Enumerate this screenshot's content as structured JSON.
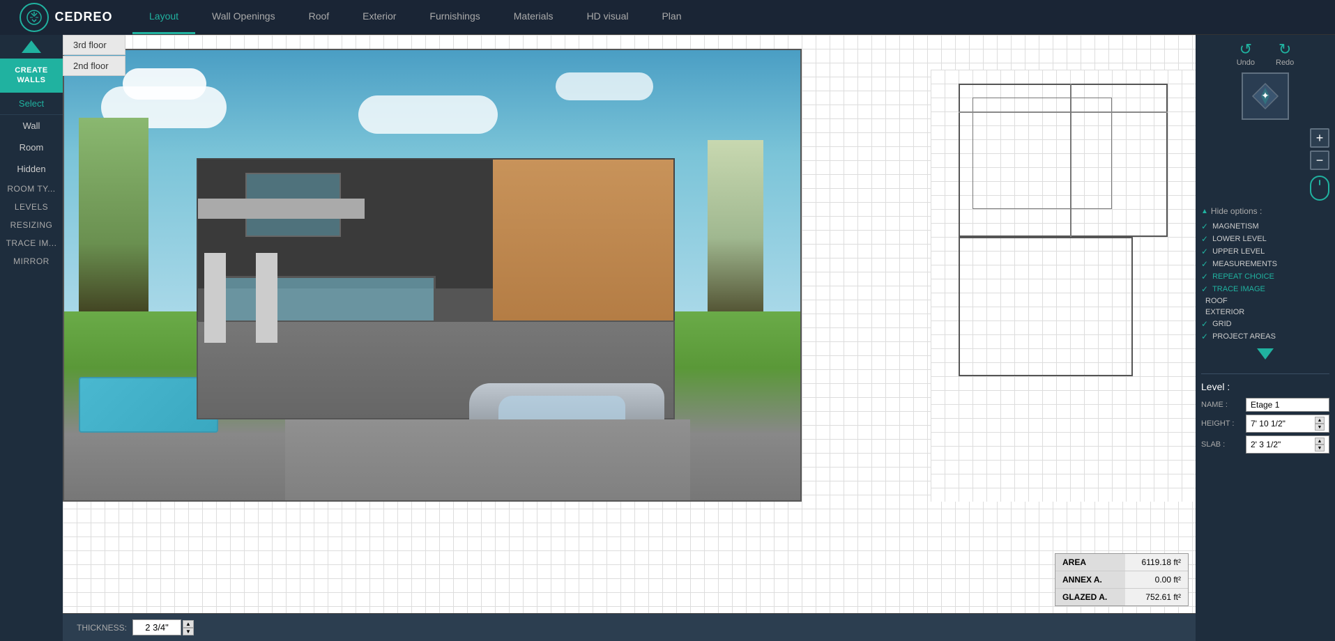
{
  "app": {
    "logo_text": "CEDREO"
  },
  "nav": {
    "tabs": [
      {
        "id": "layout",
        "label": "Layout",
        "active": true
      },
      {
        "id": "wall-openings",
        "label": "Wall Openings",
        "active": false
      },
      {
        "id": "roof",
        "label": "Roof",
        "active": false
      },
      {
        "id": "exterior",
        "label": "Exterior",
        "active": false
      },
      {
        "id": "furnishings",
        "label": "Furnishings",
        "active": false
      },
      {
        "id": "materials",
        "label": "Materials",
        "active": false
      },
      {
        "id": "hd-visual",
        "label": "HD visual",
        "active": false
      },
      {
        "id": "plan",
        "label": "Plan",
        "active": false
      }
    ]
  },
  "sidebar": {
    "create_walls_label": "CREATE WALLS",
    "select_label": "Select",
    "items": [
      {
        "id": "wall",
        "label": "Wall"
      },
      {
        "id": "room",
        "label": "Room"
      },
      {
        "id": "hidden",
        "label": "Hidden"
      }
    ],
    "sections": [
      {
        "id": "room-type",
        "label": "ROOM TY..."
      },
      {
        "id": "levels",
        "label": "LEVELS"
      },
      {
        "id": "resizing",
        "label": "RESIZING"
      },
      {
        "id": "trace-im",
        "label": "TRACE IM..."
      },
      {
        "id": "mirror",
        "label": "MIRROR"
      }
    ]
  },
  "floors": [
    {
      "id": "3rd-floor",
      "label": "3rd floor"
    },
    {
      "id": "2nd-floor",
      "label": "2nd floor"
    }
  ],
  "toolbar": {
    "undo_label": "Undo",
    "redo_label": "Redo"
  },
  "hide_options": {
    "header": "Hide options :",
    "options": [
      {
        "id": "magnetism",
        "label": "MAGNETISM",
        "checked": true
      },
      {
        "id": "lower-level",
        "label": "LOWER LEVEL",
        "checked": true
      },
      {
        "id": "upper-level",
        "label": "UPPER LEVEL",
        "checked": true
      },
      {
        "id": "measurements",
        "label": "MEASUREMENTS",
        "checked": true
      },
      {
        "id": "repeat-choice",
        "label": "REPEAT CHOICE",
        "checked": true,
        "highlighted": true
      },
      {
        "id": "trace-image",
        "label": "TRACE IMAGE",
        "checked": true,
        "highlighted": true
      },
      {
        "id": "roof",
        "label": "ROOF",
        "checked": false
      },
      {
        "id": "exterior",
        "label": "EXTERIOR",
        "checked": false
      },
      {
        "id": "grid",
        "label": "GRID",
        "checked": true
      },
      {
        "id": "project-areas",
        "label": "PROJECT AREAS",
        "checked": true
      }
    ]
  },
  "level": {
    "header": "Level :",
    "name_label": "NAME :",
    "name_value": "Etage 1",
    "height_label": "HEIGHT :",
    "height_value": "7' 10 1/2\"",
    "slab_label": "SLAB :",
    "slab_value": "2' 3 1/2\""
  },
  "area_info": {
    "rows": [
      {
        "label": "AREA",
        "value": "6119.18 ft²"
      },
      {
        "label": "ANNEX A.",
        "value": "0.00 ft²"
      },
      {
        "label": "GLAZED A.",
        "value": "752.61 ft²"
      }
    ]
  },
  "thickness": {
    "label": "THICKNESS:",
    "value": "2 3/4\""
  }
}
